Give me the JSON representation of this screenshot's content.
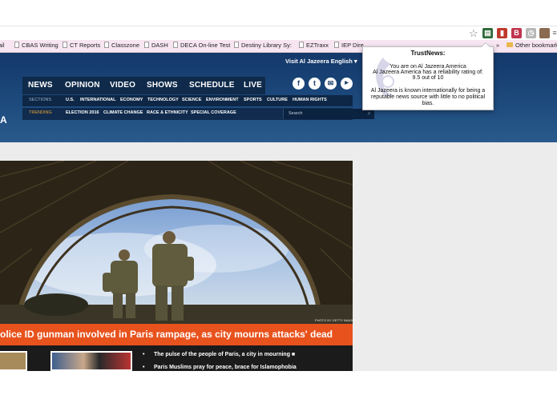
{
  "bookmarks": [
    "ail",
    "CBAS Writing",
    "CT Reports",
    "Classzone",
    "DASH",
    "DECA On-line Test",
    "Destiny Library Sy:",
    "EZTraxx",
    "IEP Dire"
  ],
  "bookmarks_more": "»",
  "bookmarks_other": "Other bookmarks",
  "header": {
    "visit": "Visit Al Jazeera English",
    "visit_caret": "▾",
    "left_letter": "A",
    "nav": [
      "NEWS",
      "OPINION",
      "VIDEO",
      "SHOWS",
      "SCHEDULE",
      "LIVE"
    ],
    "social_icons": [
      "facebook-icon",
      "twitter-icon",
      "email-icon",
      "youtube-icon"
    ],
    "sections_label": "SECTIONS",
    "sections": [
      "U.S.",
      "INTERNATIONAL",
      "ECONOMY",
      "TECHNOLOGY",
      "SCIENCE",
      "ENVIRONMENT",
      "SPORTS",
      "CULTURE",
      "HUMAN RIGHTS"
    ],
    "trending_label": "TRENDING",
    "trending": [
      "ELECTION 2016",
      "CLIMATE CHANGE",
      "RACE & ETHNICITY",
      "SPECIAL COVERAGE"
    ],
    "search_placeholder": "Search"
  },
  "story": {
    "photo_credit": "PHOTO BY GETTY IMAGES",
    "headline": "olice ID gunman involved in Paris rampage, as city mourns attacks' dead",
    "bullets": [
      "The pulse of the people of Paris, a city in mourning",
      "Paris Muslims pray for peace, brace for Islamophobia"
    ]
  },
  "popup": {
    "title": "TrustNews:",
    "line1": "You are on Al Jazeera America",
    "line2": "Al Jazeera America has a reliability rating of:",
    "line3": "9.5 out of 10",
    "line4": "Al Jazeera is known internationally for being a",
    "line5": "reputable news source with little to no political",
    "line6": "bias."
  },
  "colors": {
    "header_blue": "#1d4a7d",
    "headline_orange": "#e8521d",
    "trending_gold": "#e7a63a",
    "bookmarks_pink": "#f7e6f2"
  }
}
